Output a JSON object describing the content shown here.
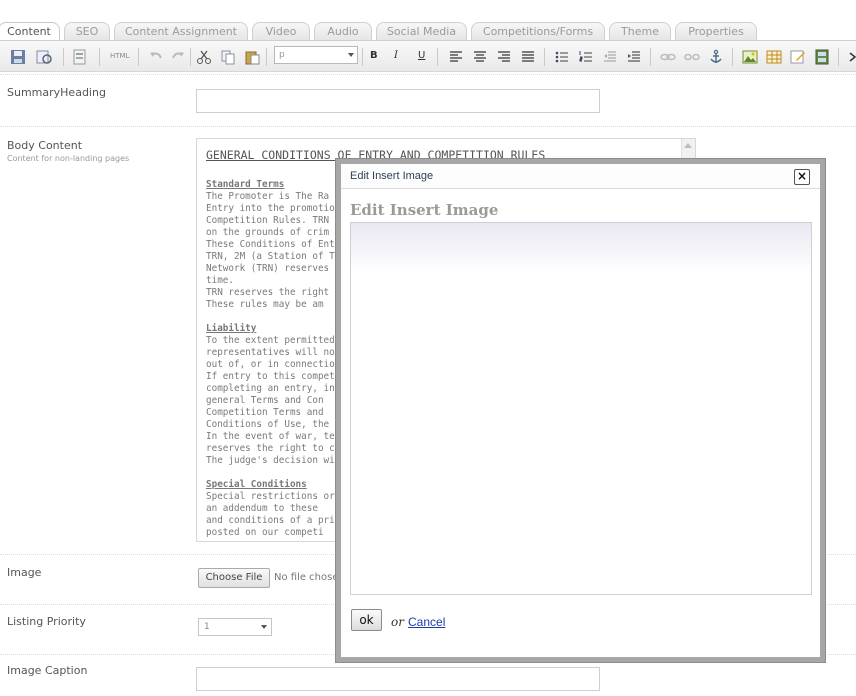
{
  "tabs": [
    {
      "label": "Content",
      "active": true
    },
    {
      "label": "SEO"
    },
    {
      "label": "Content Assignment"
    },
    {
      "label": "Video"
    },
    {
      "label": "Audio"
    },
    {
      "label": "Social Media"
    },
    {
      "label": "Competitions/Forms"
    },
    {
      "label": "Theme"
    },
    {
      "label": "Properties"
    }
  ],
  "toolbar": {
    "icons": [
      "save-icon",
      "preview-icon",
      "templates-icon",
      "source-html-icon",
      "undo-icon",
      "redo-icon",
      "cut-icon",
      "copy-icon",
      "paste-icon",
      "bold-icon",
      "italic-icon",
      "underline-icon",
      "align-left-icon",
      "align-center-icon",
      "align-right-icon",
      "justify-icon",
      "bulleted-list-icon",
      "numbered-list-icon",
      "outdent-icon",
      "indent-icon",
      "link-icon",
      "unlink-icon",
      "anchor-icon",
      "insert-image-icon",
      "table-icon",
      "edit-icon",
      "media-icon",
      "more-icon"
    ],
    "source_label": "HTML",
    "format_value": "p",
    "bold": "B",
    "italic": "I",
    "underline": "U"
  },
  "form": {
    "summary_heading_label": "SummaryHeading",
    "body_content_label": "Body Content",
    "body_content_hint": "Content for non-landing pages",
    "image_label": "Image",
    "choose_file_label": "Choose File",
    "no_file_text": "No file chose",
    "listing_priority_label": "Listing Priority",
    "listing_priority_value": "1",
    "image_caption_label": "Image Caption"
  },
  "editor": {
    "title": "GENERAL CONDITIONS OF ENTRY AND COMPETITION RULES",
    "section1_heading": "Standard Terms",
    "section1_lines": [
      "The Promoter is The Ra",
      "Entry into the promotio",
      "Competition Rules. TRN",
      "on the grounds of crim",
      "These Conditions of Ent",
      "TRN, 2M (a Station of T",
      "Network (TRN) reserves",
      "time.",
      "TRN reserves the right t",
      "These rules may be am"
    ],
    "section2_heading": "Liability",
    "section2_lines": [
      "To the extent permitted",
      "representatives will not",
      "out of, or in connection",
      "If entry to this competit",
      "completing an entry, in",
      "general Terms and Con",
      "Competition Terms and",
      "Conditions of Use, the",
      "In the event of war, ter",
      "reserves the right to ca",
      "The judge's decision wi"
    ],
    "section3_heading": "Special Conditions",
    "section3_lines": [
      "Special restrictions or c",
      "an addendum to these",
      "and conditions of a prize",
      "posted on our competi"
    ]
  },
  "modal": {
    "title": "Edit Insert Image",
    "heading": "Edit Insert Image",
    "close_glyph": "×",
    "ok_label": "ok",
    "or_text": "or",
    "cancel_label": "Cancel"
  }
}
